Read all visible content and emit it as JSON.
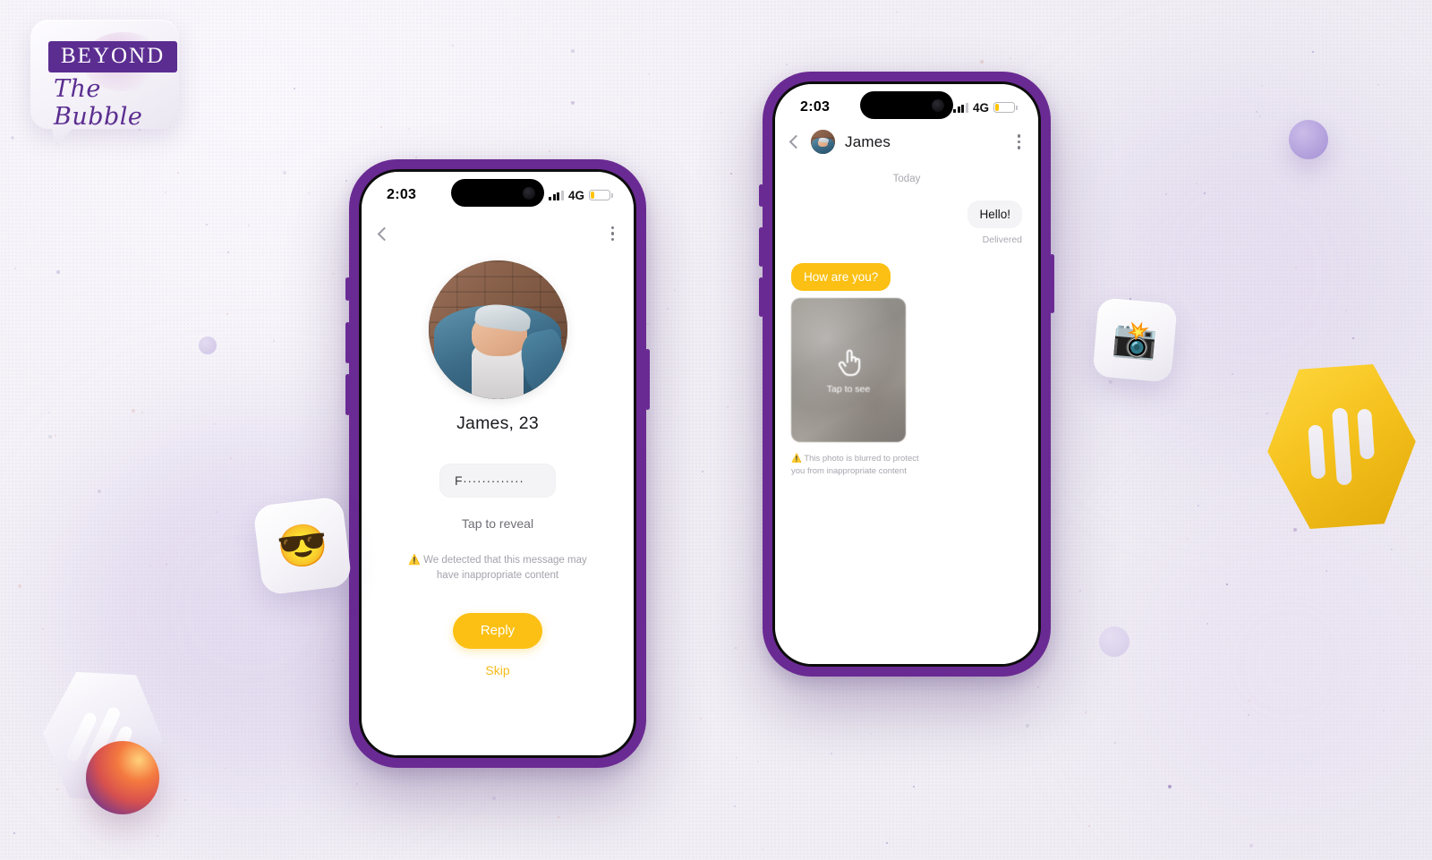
{
  "brand": {
    "word_mark": "BEYOND",
    "script_mark": "The Bubble"
  },
  "phone_1": {
    "status": {
      "time": "2:03",
      "network": "4G",
      "battery_percent": 20
    },
    "nav": {
      "back_icon": "chevron-left-icon",
      "menu_icon": "more-vertical-icon"
    },
    "profile": {
      "name_age": "James, 23",
      "avatar_alt": "man-in-beanie-photo"
    },
    "masked_message": "F·············",
    "reveal_hint": "Tap to reveal",
    "warning_icon": "⚠️",
    "warning_text": "We detected that this message may have inappropriate content",
    "primary_button": "Reply",
    "secondary_button": "Skip"
  },
  "phone_2": {
    "status": {
      "time": "2:03",
      "network": "4G",
      "battery_percent": 20
    },
    "nav": {
      "back_icon": "chevron-left-icon",
      "contact_name": "James",
      "menu_icon": "more-vertical-icon"
    },
    "chat": {
      "day_divider": "Today",
      "messages": [
        {
          "side": "outgoing",
          "text": "Hello!",
          "status": "Delivered"
        },
        {
          "side": "incoming",
          "text": "How are you?"
        }
      ],
      "blurred_photo": {
        "tap_icon": "tap-hand-icon",
        "tap_label": "Tap to see"
      },
      "warning_icon": "⚠️",
      "warning_text": "This photo is blurred to protect you from inappropriate content"
    }
  },
  "decor": {
    "tile_sunglasses_emoji": "😎",
    "tile_camera_emoji": "📸",
    "hex_yellow": "yellow-hexagon-badge",
    "hex_white": "white-hexagon-badge",
    "sphere_gradient": "gradient-sphere",
    "sphere_purple": "purple-sphere"
  },
  "colors": {
    "brand_purple": "#5b2d91",
    "phone_frame": "#6a2a93",
    "accent_yellow": "#fbc013",
    "background": "#f4f2f7"
  }
}
